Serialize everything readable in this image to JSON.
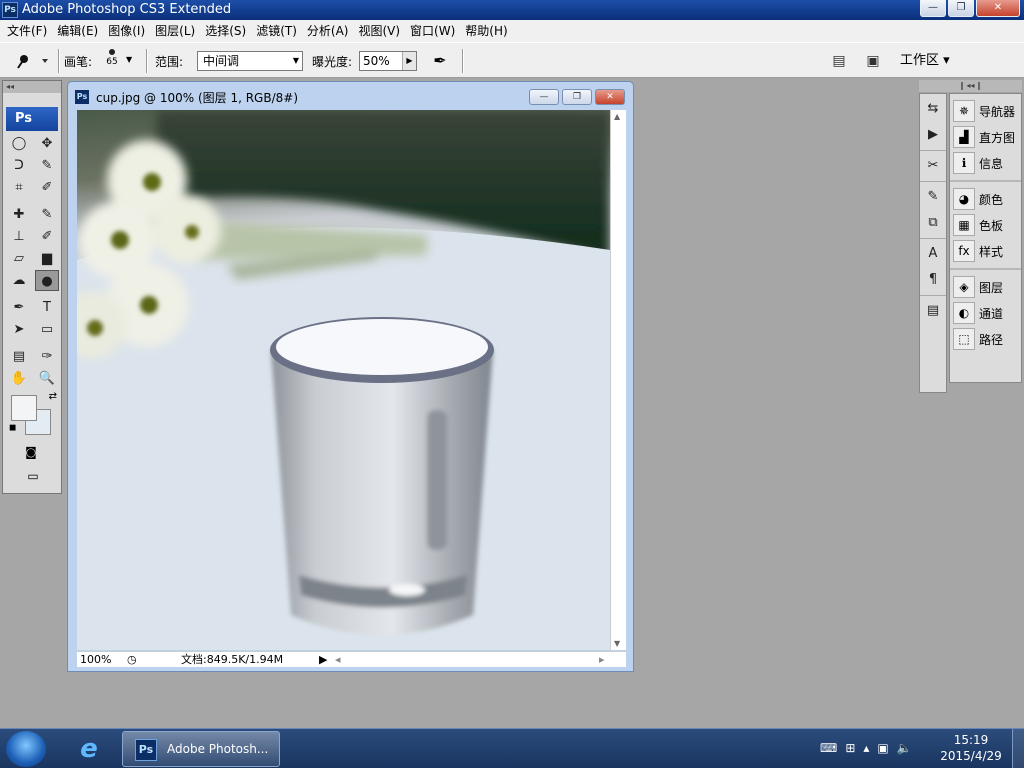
{
  "app": {
    "title": "Adobe Photoshop CS3 Extended",
    "icon": "Ps"
  },
  "window_buttons": {
    "minimize": "—",
    "maximize": "❐",
    "close": "✕"
  },
  "menu": [
    "文件(F)",
    "编辑(E)",
    "图像(I)",
    "图层(L)",
    "选择(S)",
    "滤镜(T)",
    "分析(A)",
    "视图(V)",
    "窗口(W)",
    "帮助(H)"
  ],
  "options": {
    "brush_label": "画笔:",
    "brush_size": "65",
    "range_label": "范围:",
    "range_value": "中间调",
    "exposure_label": "曝光度:",
    "exposure_value": "50%",
    "workspace_label": "工作区 ▾"
  },
  "toolbox": {
    "logo": "Ps",
    "tools": [
      [
        "◯",
        "✥"
      ],
      [
        "ᑐ",
        "✎"
      ],
      [
        "⌗",
        "✐"
      ],
      [
        "✚",
        "✎"
      ],
      [
        "⊥",
        "✐"
      ],
      [
        "▱",
        "▆"
      ],
      [
        "☁",
        "●"
      ],
      [
        "✒",
        "T"
      ],
      [
        "➤",
        "▭"
      ],
      [
        "▤",
        "✑"
      ],
      [
        "✋",
        "🔍"
      ]
    ],
    "fg_color": "#f2f4f5",
    "bg_color": "#e3ecf2"
  },
  "document": {
    "title": "cup.jpg @ 100% (图层 1, RGB/8#)",
    "icon": "Ps",
    "zoom": "100%",
    "doc_info": "文档:849.5K/1.94M"
  },
  "panels": {
    "groups": [
      [
        {
          "label": "导航器",
          "icon": "navigator-icon"
        },
        {
          "label": "直方图",
          "icon": "histogram-icon"
        },
        {
          "label": "信息",
          "icon": "info-icon"
        }
      ],
      [
        {
          "label": "颜色",
          "icon": "color-icon"
        },
        {
          "label": "色板",
          "icon": "swatches-icon"
        },
        {
          "label": "样式",
          "icon": "styles-icon"
        }
      ],
      [
        {
          "label": "图层",
          "icon": "layers-icon"
        },
        {
          "label": "通道",
          "icon": "channels-icon"
        },
        {
          "label": "路径",
          "icon": "paths-icon"
        }
      ]
    ]
  },
  "taskbar": {
    "ps_button_label": "Adobe Photosh...",
    "time": "15:19",
    "date": "2015/4/29"
  }
}
